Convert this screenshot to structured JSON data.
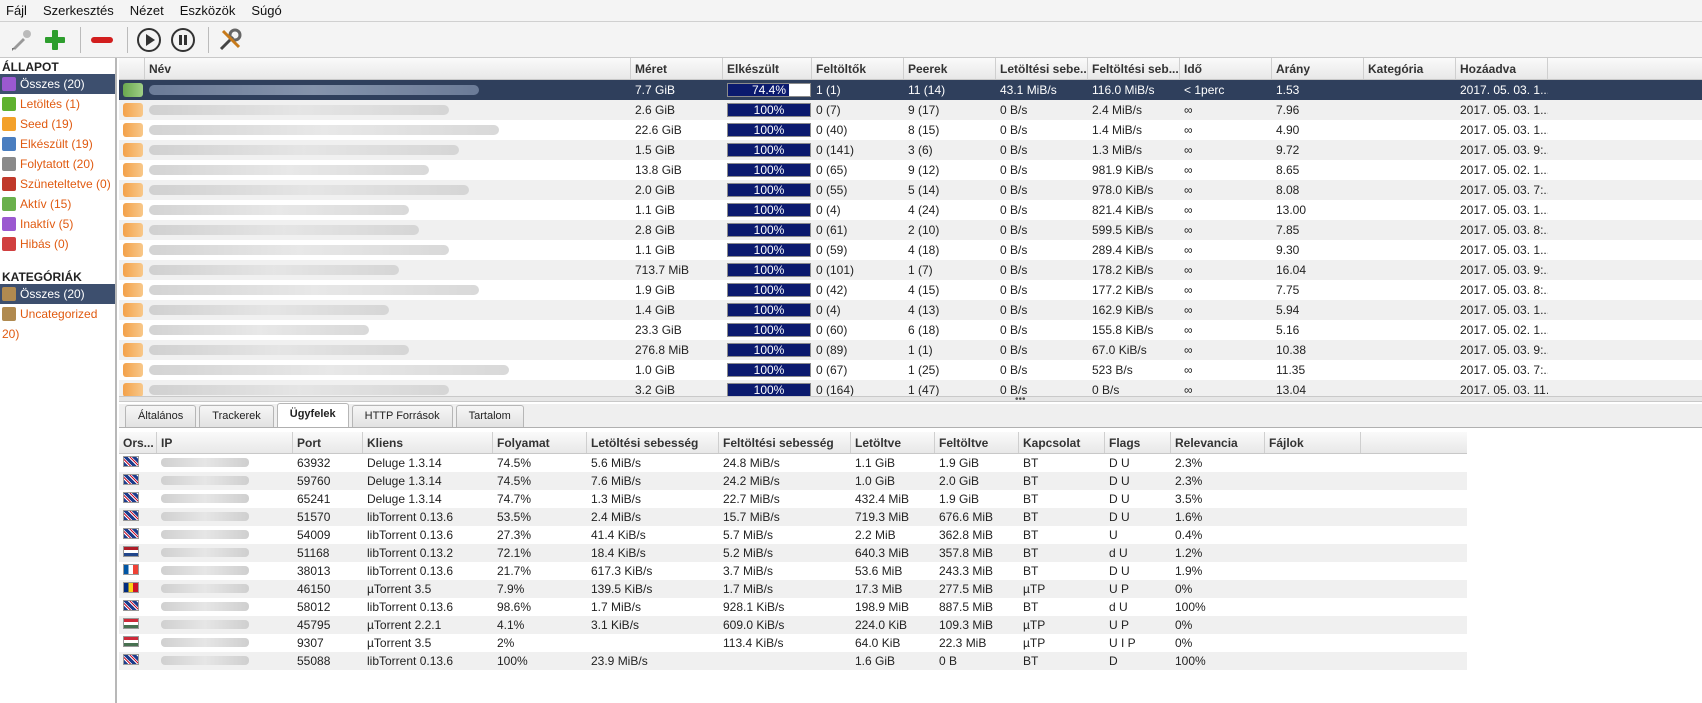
{
  "menu": [
    "Fájl",
    "Szerkesztés",
    "Nézet",
    "Eszközök",
    "Súgó"
  ],
  "toolbar": {
    "icons": [
      "add-link-icon",
      "add-torrent-icon",
      "remove-icon",
      "play-icon",
      "pause-icon",
      "preferences-icon"
    ]
  },
  "sidebar": {
    "state_header": "ÁLLAPOT",
    "states": [
      {
        "label": "Összes (20)",
        "icon": "all-icon",
        "color": "#9b59d0"
      },
      {
        "label": "Letöltés (1)",
        "icon": "download-icon",
        "color": "#5fb12f"
      },
      {
        "label": "Seed (19)",
        "icon": "seed-icon",
        "color": "#f3a12a"
      },
      {
        "label": "Elkészült (19)",
        "icon": "completed-icon",
        "color": "#4a7ec0"
      },
      {
        "label": "Folytatott (20)",
        "icon": "resumed-icon",
        "color": "#8a8a8a"
      },
      {
        "label": "Szüneteltetve (0)",
        "icon": "paused-icon",
        "color": "#c0392b"
      },
      {
        "label": "Aktív (15)",
        "icon": "active-icon",
        "color": "#6ab04c"
      },
      {
        "label": "Inaktív (5)",
        "icon": "inactive-icon",
        "color": "#9b59d0"
      },
      {
        "label": "Hibás (0)",
        "icon": "error-icon",
        "color": "#d04040"
      }
    ],
    "cat_header": "KATEGÓRIÁK",
    "categories": [
      {
        "label": "Összes (20)",
        "icon": "folder-icon"
      },
      {
        "label": "Uncategorized",
        "icon": "folder-icon"
      }
    ],
    "cat_wrap": "20)"
  },
  "torrents": {
    "columns": [
      "Név",
      "Méret",
      "Elkészült",
      "Feltöltők",
      "Peerek",
      "Letöltési sebe...",
      "Feltöltési seb...",
      "Idő",
      "Arány",
      "Kategória",
      "Hozáadva"
    ],
    "rows": [
      {
        "size": "7.7 GiB",
        "progress": 0.744,
        "progress_text": "74.4%",
        "seeds": "1 (1)",
        "peers": "11 (14)",
        "dl": "43.1 MiB/s",
        "ul": "116.0 MiB/s",
        "eta": "< 1perc",
        "ratio": "1.53",
        "category": "",
        "added": "2017. 05. 03. 1..."
      },
      {
        "size": "2.6 GiB",
        "progress": 1,
        "progress_text": "100%",
        "seeds": "0 (7)",
        "peers": "9 (17)",
        "dl": "0 B/s",
        "ul": "2.4 MiB/s",
        "eta": "∞",
        "ratio": "7.96",
        "category": "",
        "added": "2017. 05. 03. 1..."
      },
      {
        "size": "22.6 GiB",
        "progress": 1,
        "progress_text": "100%",
        "seeds": "0 (40)",
        "peers": "8 (15)",
        "dl": "0 B/s",
        "ul": "1.4 MiB/s",
        "eta": "∞",
        "ratio": "4.90",
        "category": "",
        "added": "2017. 05. 03. 1..."
      },
      {
        "size": "1.5 GiB",
        "progress": 1,
        "progress_text": "100%",
        "seeds": "0 (141)",
        "peers": "3 (6)",
        "dl": "0 B/s",
        "ul": "1.3 MiB/s",
        "eta": "∞",
        "ratio": "9.72",
        "category": "",
        "added": "2017. 05. 03. 9:..."
      },
      {
        "size": "13.8 GiB",
        "progress": 1,
        "progress_text": "100%",
        "seeds": "0 (65)",
        "peers": "9 (12)",
        "dl": "0 B/s",
        "ul": "981.9 KiB/s",
        "eta": "∞",
        "ratio": "8.65",
        "category": "",
        "added": "2017. 05. 02. 1..."
      },
      {
        "size": "2.0 GiB",
        "progress": 1,
        "progress_text": "100%",
        "seeds": "0 (55)",
        "peers": "5 (14)",
        "dl": "0 B/s",
        "ul": "978.0 KiB/s",
        "eta": "∞",
        "ratio": "8.08",
        "category": "",
        "added": "2017. 05. 03. 7:..."
      },
      {
        "size": "1.1 GiB",
        "progress": 1,
        "progress_text": "100%",
        "seeds": "0 (4)",
        "peers": "4 (24)",
        "dl": "0 B/s",
        "ul": "821.4 KiB/s",
        "eta": "∞",
        "ratio": "13.00",
        "category": "",
        "added": "2017. 05. 03. 1..."
      },
      {
        "size": "2.8 GiB",
        "progress": 1,
        "progress_text": "100%",
        "seeds": "0 (61)",
        "peers": "2 (10)",
        "dl": "0 B/s",
        "ul": "599.5 KiB/s",
        "eta": "∞",
        "ratio": "7.85",
        "category": "",
        "added": "2017. 05. 03. 8:..."
      },
      {
        "size": "1.1 GiB",
        "progress": 1,
        "progress_text": "100%",
        "seeds": "0 (59)",
        "peers": "4 (18)",
        "dl": "0 B/s",
        "ul": "289.4 KiB/s",
        "eta": "∞",
        "ratio": "9.30",
        "category": "",
        "added": "2017. 05. 03. 1..."
      },
      {
        "size": "713.7 MiB",
        "progress": 1,
        "progress_text": "100%",
        "seeds": "0 (101)",
        "peers": "1 (7)",
        "dl": "0 B/s",
        "ul": "178.2 KiB/s",
        "eta": "∞",
        "ratio": "16.04",
        "category": "",
        "added": "2017. 05. 03. 9:..."
      },
      {
        "size": "1.9 GiB",
        "progress": 1,
        "progress_text": "100%",
        "seeds": "0 (42)",
        "peers": "4 (15)",
        "dl": "0 B/s",
        "ul": "177.2 KiB/s",
        "eta": "∞",
        "ratio": "7.75",
        "category": "",
        "added": "2017. 05. 03. 8:..."
      },
      {
        "size": "1.4 GiB",
        "progress": 1,
        "progress_text": "100%",
        "seeds": "0 (4)",
        "peers": "4 (13)",
        "dl": "0 B/s",
        "ul": "162.9 KiB/s",
        "eta": "∞",
        "ratio": "5.94",
        "category": "",
        "added": "2017. 05. 03. 1..."
      },
      {
        "size": "23.3 GiB",
        "progress": 1,
        "progress_text": "100%",
        "seeds": "0 (60)",
        "peers": "6 (18)",
        "dl": "0 B/s",
        "ul": "155.8 KiB/s",
        "eta": "∞",
        "ratio": "5.16",
        "category": "",
        "added": "2017. 05. 02. 1..."
      },
      {
        "size": "276.8 MiB",
        "progress": 1,
        "progress_text": "100%",
        "seeds": "0 (89)",
        "peers": "1 (1)",
        "dl": "0 B/s",
        "ul": "67.0 KiB/s",
        "eta": "∞",
        "ratio": "10.38",
        "category": "",
        "added": "2017. 05. 03. 9:..."
      },
      {
        "size": "1.0 GiB",
        "progress": 1,
        "progress_text": "100%",
        "seeds": "0 (67)",
        "peers": "1 (25)",
        "dl": "0 B/s",
        "ul": "523 B/s",
        "eta": "∞",
        "ratio": "11.35",
        "category": "",
        "added": "2017. 05. 03. 7:..."
      },
      {
        "size": "3.2 GiB",
        "progress": 1,
        "progress_text": "100%",
        "seeds": "0 (164)",
        "peers": "1 (47)",
        "dl": "0 B/s",
        "ul": "0 B/s",
        "eta": "∞",
        "ratio": "13.04",
        "category": "",
        "added": "2017. 05. 03. 11..."
      }
    ]
  },
  "tabs": [
    "Általános",
    "Trackerek",
    "Ügyfelek",
    "HTTP Források",
    "Tartalom"
  ],
  "active_tab": "Ügyfelek",
  "peers": {
    "columns": [
      "Ors...",
      "IP",
      "Port",
      "Kliens",
      "Folyamat",
      "Letöltési sebesség",
      "Feltöltési sebesség",
      "Letöltve",
      "Feltöltve",
      "Kapcsolat",
      "Flags",
      "Relevancia",
      "Fájlok"
    ],
    "rows": [
      {
        "flag": "uk",
        "port": "63932",
        "client": "Deluge 1.3.14",
        "progress": "74.5%",
        "dl": "5.6 MiB/s",
        "ul": "24.8 MiB/s",
        "downloaded": "1.1 GiB",
        "uploaded": "1.9 GiB",
        "conn": "BT",
        "flags": "D U",
        "relevance": "2.3%"
      },
      {
        "flag": "uk",
        "port": "59760",
        "client": "Deluge 1.3.14",
        "progress": "74.5%",
        "dl": "7.6 MiB/s",
        "ul": "24.2 MiB/s",
        "downloaded": "1.0 GiB",
        "uploaded": "2.0 GiB",
        "conn": "BT",
        "flags": "D U",
        "relevance": "2.3%"
      },
      {
        "flag": "uk",
        "port": "65241",
        "client": "Deluge 1.3.14",
        "progress": "74.7%",
        "dl": "1.3 MiB/s",
        "ul": "22.7 MiB/s",
        "downloaded": "432.4 MiB",
        "uploaded": "1.9 GiB",
        "conn": "BT",
        "flags": "D U",
        "relevance": "3.5%"
      },
      {
        "flag": "uk",
        "port": "51570",
        "client": "libTorrent 0.13.6",
        "progress": "53.5%",
        "dl": "2.4 MiB/s",
        "ul": "15.7 MiB/s",
        "downloaded": "719.3 MiB",
        "uploaded": "676.6 MiB",
        "conn": "BT",
        "flags": "D U",
        "relevance": "1.6%"
      },
      {
        "flag": "uk",
        "port": "54009",
        "client": "libTorrent 0.13.6",
        "progress": "27.3%",
        "dl": "41.4 KiB/s",
        "ul": "5.7 MiB/s",
        "downloaded": "2.2 MiB",
        "uploaded": "362.8 MiB",
        "conn": "BT",
        "flags": "U",
        "relevance": "0.4%"
      },
      {
        "flag": "nl",
        "port": "51168",
        "client": "libTorrent 0.13.2",
        "progress": "72.1%",
        "dl": "18.4 KiB/s",
        "ul": "5.2 MiB/s",
        "downloaded": "640.3 MiB",
        "uploaded": "357.8 MiB",
        "conn": "BT",
        "flags": "d U",
        "relevance": "1.2%"
      },
      {
        "flag": "fr",
        "port": "38013",
        "client": "libTorrent 0.13.6",
        "progress": "21.7%",
        "dl": "617.3 KiB/s",
        "ul": "3.7 MiB/s",
        "downloaded": "53.6 MiB",
        "uploaded": "243.3 MiB",
        "conn": "BT",
        "flags": "D U",
        "relevance": "1.9%"
      },
      {
        "flag": "ro",
        "port": "46150",
        "client": "µTorrent 3.5",
        "progress": "7.9%",
        "dl": "139.5 KiB/s",
        "ul": "1.7 MiB/s",
        "downloaded": "17.3 MiB",
        "uploaded": "277.5 MiB",
        "conn": "µTP",
        "flags": "U P",
        "relevance": "0%"
      },
      {
        "flag": "uk",
        "port": "58012",
        "client": "libTorrent 0.13.6",
        "progress": "98.6%",
        "dl": "1.7 MiB/s",
        "ul": "928.1 KiB/s",
        "downloaded": "198.9 MiB",
        "uploaded": "887.5 MiB",
        "conn": "BT",
        "flags": "d U",
        "relevance": "100%"
      },
      {
        "flag": "hu",
        "port": "45795",
        "client": "µTorrent 2.2.1",
        "progress": "4.1%",
        "dl": "3.1 KiB/s",
        "ul": "609.0 KiB/s",
        "downloaded": "224.0 KiB",
        "uploaded": "109.3 MiB",
        "conn": "µTP",
        "flags": "U P",
        "relevance": "0%"
      },
      {
        "flag": "hu",
        "port": "9307",
        "client": "µTorrent 3.5",
        "progress": "2%",
        "dl": "",
        "ul": "113.4 KiB/s",
        "downloaded": "64.0 KiB",
        "uploaded": "22.3 MiB",
        "conn": "µTP",
        "flags": "U I P",
        "relevance": "0%"
      },
      {
        "flag": "uk",
        "port": "55088",
        "client": "libTorrent 0.13.6",
        "progress": "100%",
        "dl": "23.9 MiB/s",
        "ul": "",
        "downloaded": "1.6 GiB",
        "uploaded": "0 B",
        "conn": "BT",
        "flags": "D",
        "relevance": "100%"
      }
    ]
  },
  "colors": {
    "accent": "#e05a10",
    "selection": "#2f3f5c",
    "progress": "#0b1a6e"
  }
}
